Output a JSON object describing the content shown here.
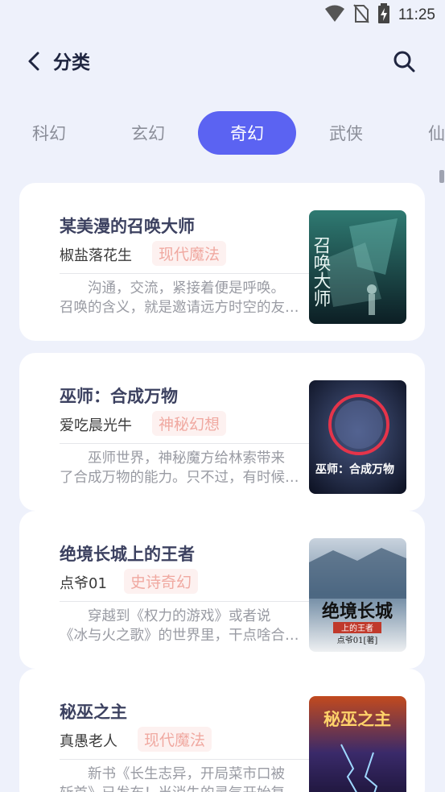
{
  "status_bar": {
    "time": "11:25"
  },
  "header": {
    "title": "分类"
  },
  "tabs": [
    {
      "label": "科幻",
      "active": false
    },
    {
      "label": "玄幻",
      "active": false
    },
    {
      "label": "奇幻",
      "active": true
    },
    {
      "label": "武侠",
      "active": false
    },
    {
      "label": "仙",
      "active": false
    }
  ],
  "books": [
    {
      "title": "某美漫的召唤大师",
      "author": "椒盐落花生",
      "tag": "现代魔法",
      "desc_line1": "沟通，交流，紧接着便是呼唤。",
      "desc_line2": "召唤的含义，就是邀请远方时空的友…",
      "cover_title": "召唤大师"
    },
    {
      "title": "巫师：合成万物",
      "author": "爱吃晨光牛",
      "tag": "神秘幻想",
      "desc_line1": "巫师世界，神秘魔方给林索带来",
      "desc_line2": "了合成万物的能力。只不过，有时候…",
      "cover_title": "巫师：合成万物"
    },
    {
      "title": "绝境长城上的王者",
      "author": "点爷01",
      "tag": "史诗奇幻",
      "desc_line1": "穿越到《权力的游戏》或者说",
      "desc_line2": "《冰与火之歌》的世界里，干点啥合…",
      "cover_title": "绝境长城",
      "cover_subtitle": "上的王者",
      "cover_author": "点爷01[著]"
    },
    {
      "title": "秘巫之主",
      "author": "真愚老人",
      "tag": "现代魔法",
      "desc_line1": "新书《长生志异，开局菜市口被",
      "desc_line2": "斩首》已发布！当消失的灵气开始复…",
      "cover_title": "秘巫之主"
    }
  ],
  "colors": {
    "accent": "#5b63f2",
    "background": "#eef1fb",
    "tag_bg": "#fdf1f0",
    "tag_text": "#f0a9a1"
  },
  "icons": {
    "back": "chevron-left-icon",
    "search": "search-icon",
    "wifi": "wifi-icon",
    "no_sim": "no-sim-icon",
    "battery": "battery-charging-icon"
  }
}
